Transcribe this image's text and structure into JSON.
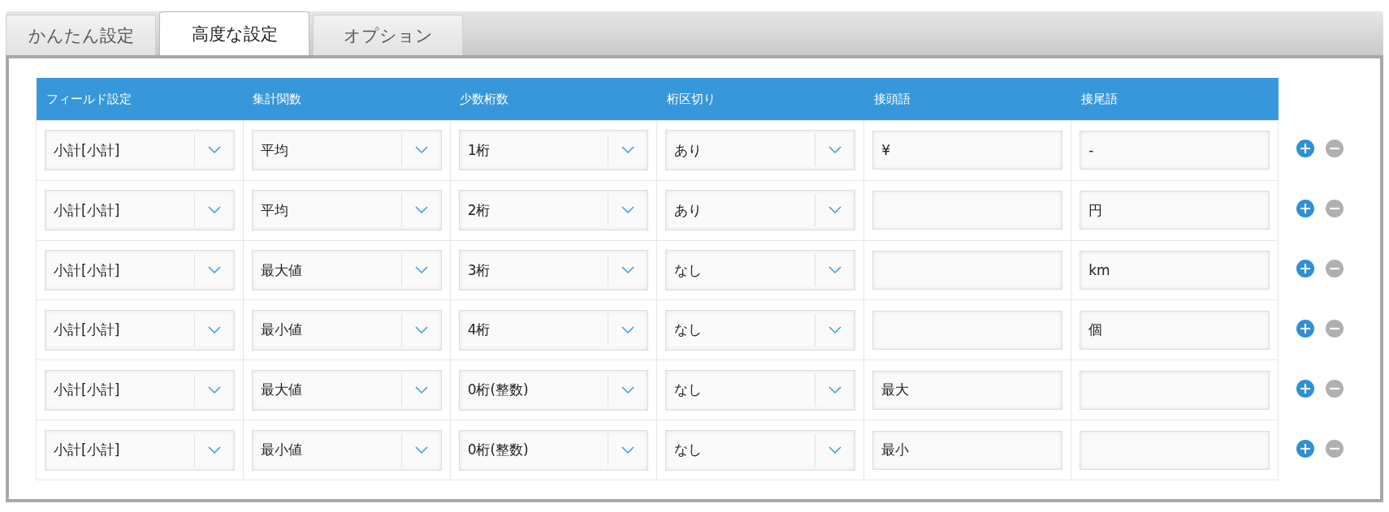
{
  "tabs": [
    {
      "label": "かんたん設定",
      "selected": false
    },
    {
      "label": "高度な設定",
      "selected": true
    },
    {
      "label": "オプション",
      "selected": false
    }
  ],
  "table": {
    "columns": [
      "フィールド設定",
      "集計関数",
      "少数桁数",
      "桁区切り",
      "接頭語",
      "接尾語"
    ],
    "rows": [
      {
        "cells": [
          {
            "kind": "select",
            "value": "小計[小計]"
          },
          {
            "kind": "select",
            "value": "平均"
          },
          {
            "kind": "select",
            "value": "1桁"
          },
          {
            "kind": "select",
            "value": "あり"
          },
          {
            "kind": "text",
            "value": "¥"
          },
          {
            "kind": "text",
            "value": "-"
          }
        ]
      },
      {
        "cells": [
          {
            "kind": "select",
            "value": "小計[小計]"
          },
          {
            "kind": "select",
            "value": "平均"
          },
          {
            "kind": "select",
            "value": "2桁"
          },
          {
            "kind": "select",
            "value": "あり"
          },
          {
            "kind": "text"
          },
          {
            "kind": "text",
            "value": "円"
          }
        ]
      },
      {
        "cells": [
          {
            "kind": "select",
            "value": "小計[小計]"
          },
          {
            "kind": "select",
            "value": "最大値"
          },
          {
            "kind": "select",
            "value": "3桁"
          },
          {
            "kind": "select",
            "value": "なし"
          },
          {
            "kind": "text"
          },
          {
            "kind": "text",
            "value": "km"
          }
        ]
      },
      {
        "cells": [
          {
            "kind": "select",
            "value": "小計[小計]"
          },
          {
            "kind": "select",
            "value": "最小値"
          },
          {
            "kind": "select",
            "value": "4桁"
          },
          {
            "kind": "select",
            "value": "なし"
          },
          {
            "kind": "text"
          },
          {
            "kind": "text",
            "value": "個"
          }
        ]
      },
      {
        "cells": [
          {
            "kind": "select",
            "value": "小計[小計]"
          },
          {
            "kind": "select",
            "value": "最大値"
          },
          {
            "kind": "select",
            "value": "0桁(整数)"
          },
          {
            "kind": "select",
            "value": "なし"
          },
          {
            "kind": "text",
            "value": "最大"
          },
          {
            "kind": "text"
          }
        ]
      },
      {
        "cells": [
          {
            "kind": "select",
            "value": "小計[小計]"
          },
          {
            "kind": "select",
            "value": "最小値"
          },
          {
            "kind": "select",
            "value": "0桁(整数)"
          },
          {
            "kind": "select",
            "value": "なし"
          },
          {
            "kind": "text",
            "value": "最小"
          },
          {
            "kind": "text"
          }
        ]
      }
    ]
  }
}
